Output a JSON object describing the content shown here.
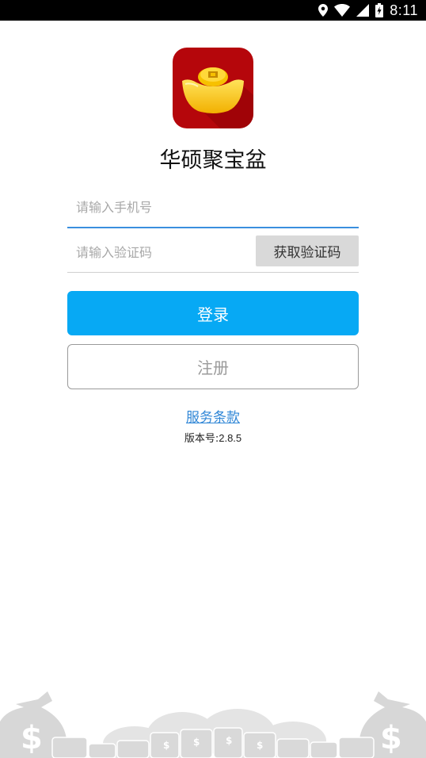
{
  "status_bar": {
    "time": "8:11",
    "icons": [
      "location-icon",
      "wifi-icon",
      "cell-signal-icon",
      "battery-icon"
    ]
  },
  "app": {
    "name": "华硕聚宝盆",
    "logo_icon": "gold-ingot-icon"
  },
  "form": {
    "phone_placeholder": "请输入手机号",
    "phone_value": "",
    "code_placeholder": "请输入验证码",
    "code_value": "",
    "get_code_label": "获取验证码",
    "login_label": "登录",
    "register_label": "注册"
  },
  "footer": {
    "terms_label": "服务条款",
    "version_label": "版本号:",
    "version_value": "2.8.5",
    "decoration": "money-bags-and-coins-illustration"
  },
  "colors": {
    "accent": "#07a9f4",
    "focus_underline": "#3a8fde",
    "logo_background": "#b5060b",
    "link": "#2f86d6",
    "ingot": "#fcc800"
  }
}
